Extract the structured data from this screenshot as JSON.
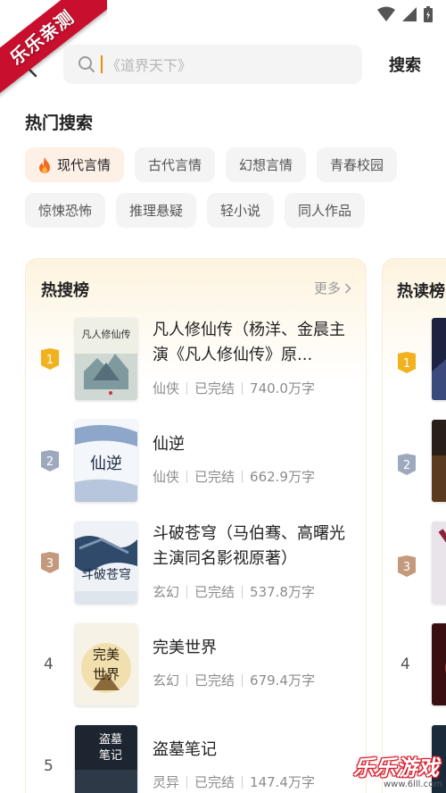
{
  "watermark": {
    "ribbon": "乐乐亲测",
    "bottom": "乐乐游戏",
    "url": "www.6lll.com"
  },
  "header": {
    "search_placeholder": "《道界天下》",
    "search_button": "搜索"
  },
  "hot_search": {
    "title": "热门搜索",
    "row1": [
      "现代言情",
      "古代言情",
      "幻想言情",
      "青春校园"
    ],
    "row2": [
      "惊悚恐怖",
      "推理悬疑",
      "轻小说",
      "同人作品"
    ]
  },
  "hot_rank": {
    "title": "热搜榜",
    "more": "更多",
    "items": [
      {
        "rank": "1",
        "title": "凡人修仙传（杨洋、金晨主演《凡人修仙传》原...",
        "genre": "仙侠",
        "status": "已完结",
        "words": "740.0万字"
      },
      {
        "rank": "2",
        "title": "仙逆",
        "genre": "仙侠",
        "status": "已完结",
        "words": "662.9万字"
      },
      {
        "rank": "3",
        "title": "斗破苍穹（马伯骞、高曙光主演同名影视原著）",
        "genre": "玄幻",
        "status": "已完结",
        "words": "537.8万字"
      },
      {
        "rank": "4",
        "title": "完美世界",
        "genre": "玄幻",
        "status": "已完结",
        "words": "679.4万字"
      },
      {
        "rank": "5",
        "title": "盗墓笔记",
        "genre": "灵异",
        "status": "已完结",
        "words": "147.4万字"
      }
    ]
  },
  "read_rank": {
    "title": "热读榜",
    "ranks": [
      "1",
      "2",
      "3",
      "4"
    ]
  },
  "colors": {
    "accent": "#f08a00",
    "gold": "#f2b11e",
    "silver": "#9fa9bd",
    "bronze": "#c39a7e",
    "tag_bg": "#f4f4f5",
    "hot_tag_bg": "#fdf0e6"
  }
}
